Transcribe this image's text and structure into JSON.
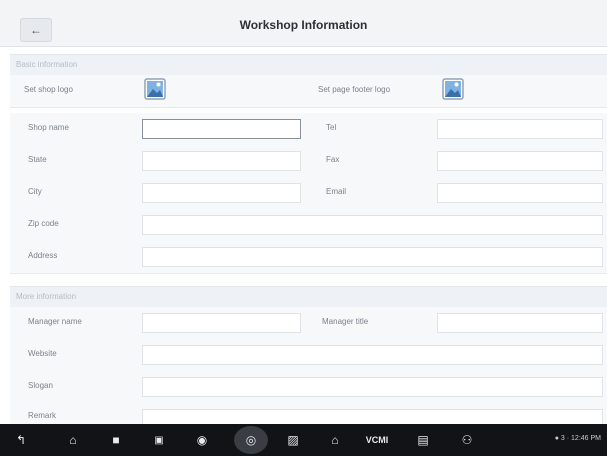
{
  "header": {
    "back_icon": "back-arrow-icon",
    "title": "Workshop Information"
  },
  "sections": {
    "basic": "Basic information",
    "more": "More information"
  },
  "basic": {
    "shop_logo_label": "Set shop logo",
    "footer_logo_label": "Set page footer logo",
    "shop_name_label": "Shop name",
    "tel_label": "Tel",
    "state_label": "State",
    "fax_label": "Fax",
    "city_label": "City",
    "email_label": "Email",
    "zip_label": "Zip code",
    "address_label": "Address"
  },
  "more": {
    "manager_name_label": "Manager name",
    "manager_title_label": "Manager title",
    "website_label": "Website",
    "slogan_label": "Slogan",
    "remark_label": "Remark"
  },
  "navbar": {
    "icons": [
      "back-icon",
      "home-icon",
      "recent-apps-icon",
      "window-icon",
      "browser-icon",
      "camera-icon",
      "screen-record-icon",
      "house-icon",
      "vcm-icon",
      "car-icon",
      "people-icon"
    ],
    "vcm_label": "VCMI",
    "status": "● 3 · 12:46 PM"
  },
  "colors": {
    "header_bg": "#f3f4f6",
    "section_bg": "#eef1f5",
    "row_bg": "#f7f8fa",
    "navbar_bg": "#111317"
  }
}
